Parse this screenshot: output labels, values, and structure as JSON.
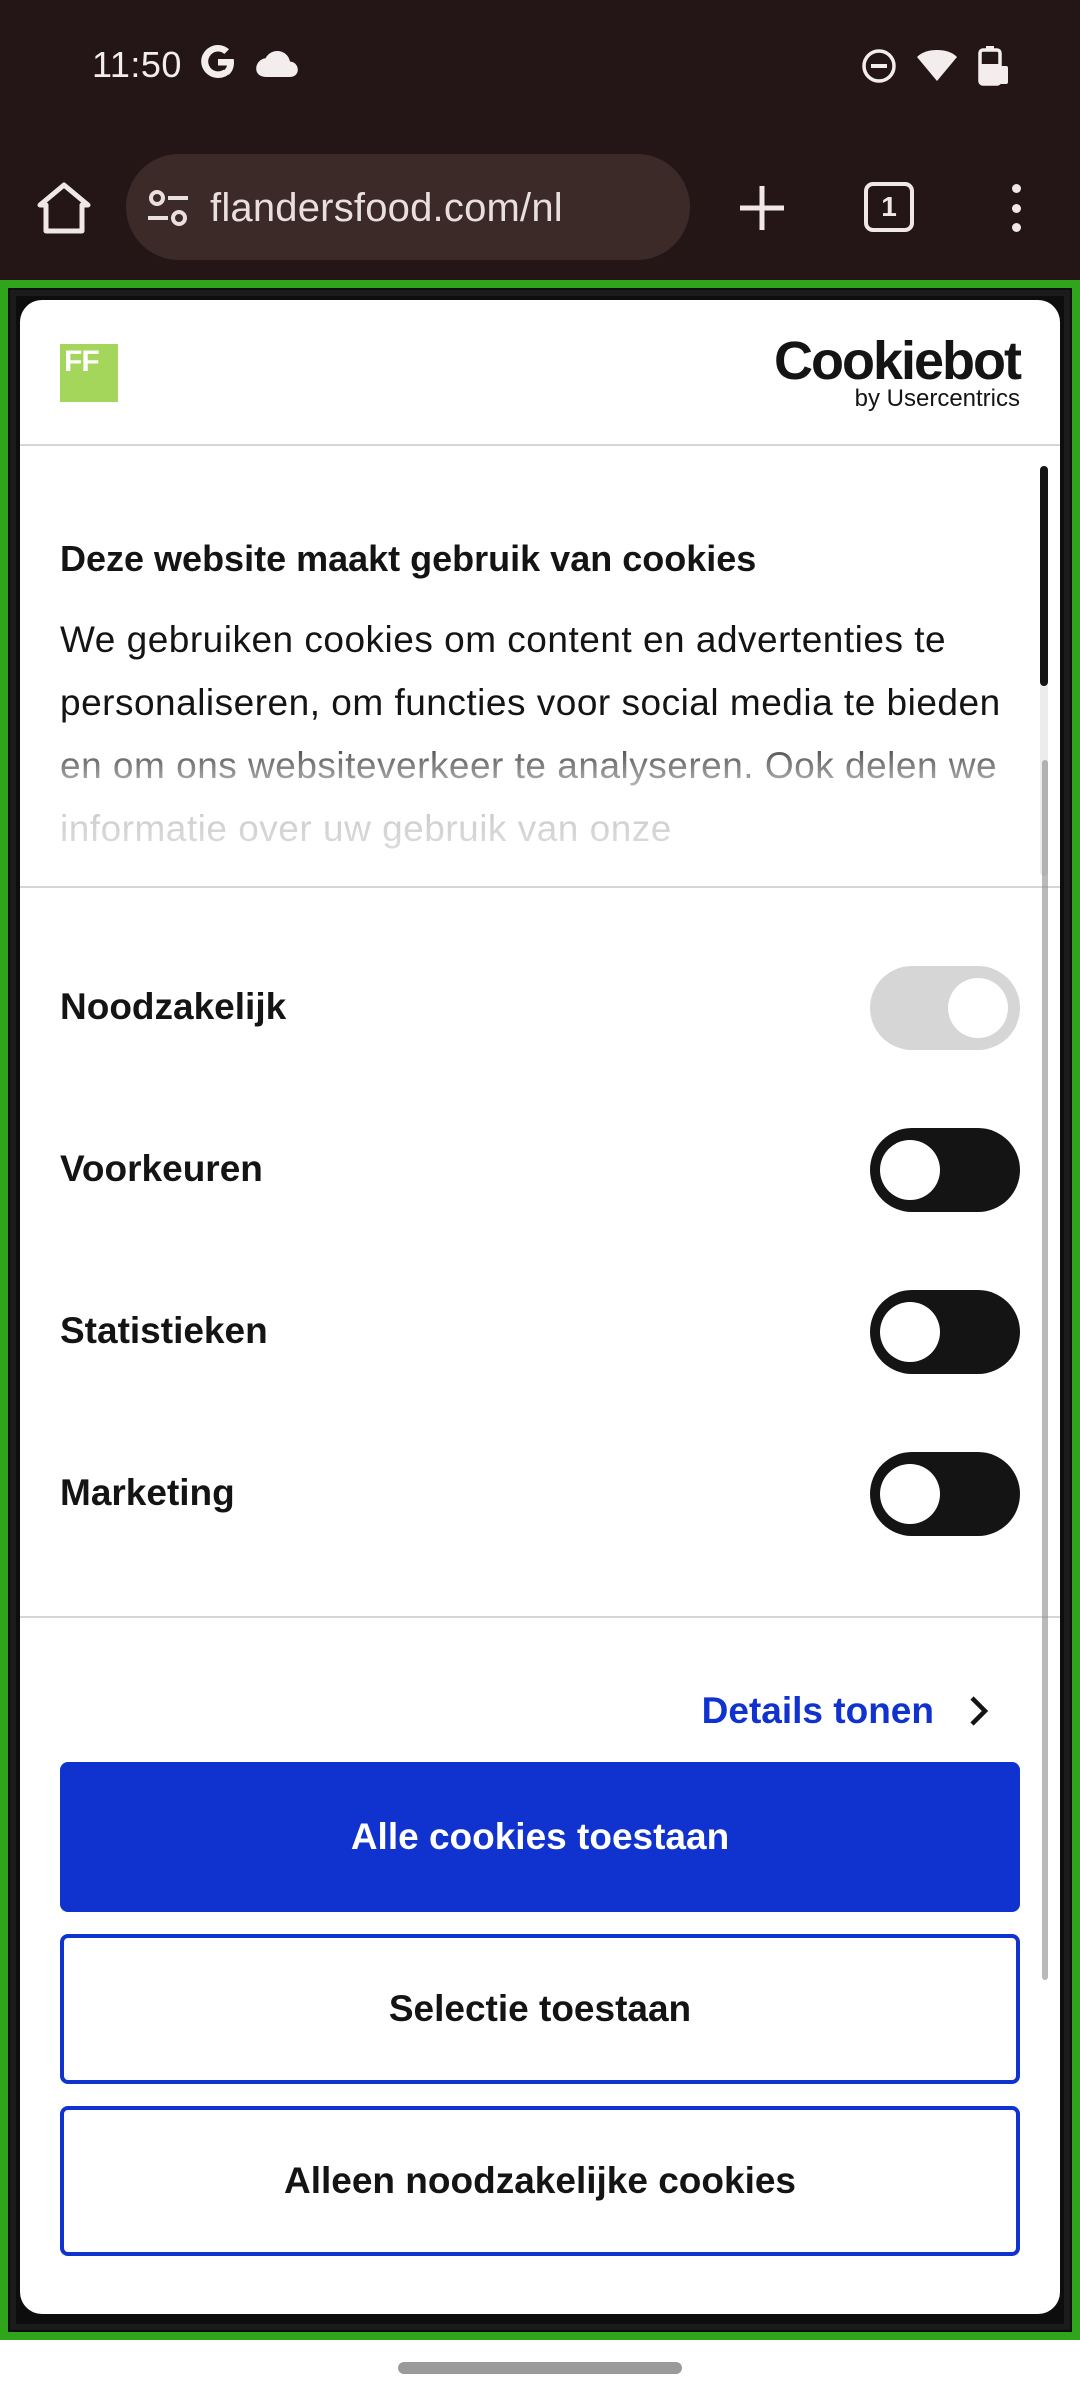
{
  "status_bar": {
    "time": "11:50",
    "icons": [
      "google-g-icon",
      "cloud-icon",
      "do-not-disturb-icon",
      "wifi-icon",
      "battery-icon"
    ]
  },
  "browser": {
    "url": "flandersfood.com/nl",
    "tab_count": "1",
    "icons": [
      "home-icon",
      "site-settings-icon",
      "new-tab-icon",
      "tabs-icon",
      "more-menu-icon"
    ]
  },
  "dialog": {
    "logo_text": "FF",
    "cookiebot": {
      "name": "Cookiebot",
      "by": "by Usercentrics"
    },
    "title": "Deze website maakt gebruik van cookies",
    "body": "We gebruiken cookies om content en advertenties te personaliseren, om functies voor social media te bieden en om ons websiteverkeer te analyseren. Ook delen we informatie over uw gebruik van onze",
    "toggles": [
      {
        "label": "Noodzakelijk",
        "state": "on-disabled"
      },
      {
        "label": "Voorkeuren",
        "state": "off"
      },
      {
        "label": "Statistieken",
        "state": "off"
      },
      {
        "label": "Marketing",
        "state": "off"
      }
    ],
    "details_link": "Details tonen",
    "buttons": {
      "allow_all": "Alle cookies toestaan",
      "allow_selection": "Selectie toestaan",
      "necessary_only": "Alleen noodzakelijke cookies"
    }
  },
  "colors": {
    "accent": "#1032cf",
    "frame": "#2fa51c",
    "system_bg": "#241616",
    "logo_green": "#a3d65a"
  }
}
